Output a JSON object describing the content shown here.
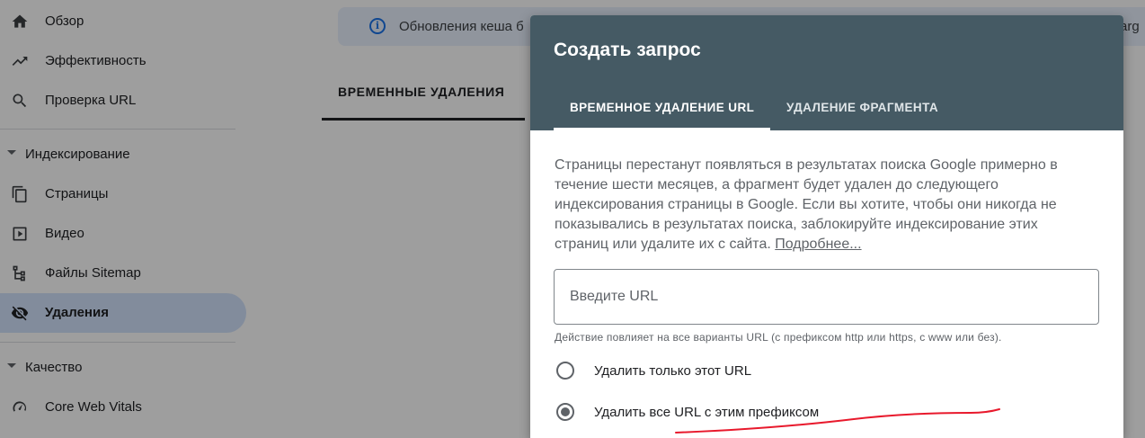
{
  "sidebar": {
    "items": [
      {
        "label": "Обзор",
        "icon": "home-icon"
      },
      {
        "label": "Эффективность",
        "icon": "trending-up-icon"
      },
      {
        "label": "Проверка URL",
        "icon": "search-icon"
      }
    ],
    "indexing": {
      "section_label": "Индексирование",
      "items": [
        {
          "label": "Страницы",
          "icon": "pages-icon"
        },
        {
          "label": "Видео",
          "icon": "video-icon"
        },
        {
          "label": "Файлы Sitemap",
          "icon": "sitemap-icon"
        },
        {
          "label": "Удаления",
          "icon": "eye-off-icon",
          "active": true
        }
      ]
    },
    "quality": {
      "section_label": "Качество",
      "items": [
        {
          "label": "Core Web Vitals",
          "icon": "gauge-icon"
        }
      ]
    }
  },
  "main": {
    "banner_text": "Обновления кеша б",
    "banner_text_right": "arg",
    "tab_label": "ВРЕМЕННЫЕ УДАЛЕНИЯ"
  },
  "dialog": {
    "title": "Создать запрос",
    "tabs": [
      {
        "label": "ВРЕМЕННОЕ УДАЛЕНИЕ URL",
        "selected": true
      },
      {
        "label": "УДАЛЕНИЕ ФРАГМЕНТА",
        "selected": false
      }
    ],
    "description": "Страницы перестанут появляться в результатах поиска Google примерно в течение шести месяцев, а фрагмент будет удален до следующего индексирования страницы в Google. Если вы хотите, чтобы они никогда не показывались в результатах поиска, заблокируйте индексирование этих страниц или удалите их с сайта.",
    "learn_more": "Подробнее...",
    "url_input": {
      "placeholder": "Введите URL",
      "value": ""
    },
    "hint": "Действие повлияет на все варианты URL (с префиксом http или https, с www или без).",
    "options": [
      {
        "label": "Удалить только этот URL",
        "checked": false
      },
      {
        "label": "Удалить все URL с этим префиксом",
        "checked": true
      }
    ]
  },
  "colors": {
    "dialog_header": "#455a64",
    "active_nav": "#d2e3fc",
    "annotation_stroke": "#e8192c"
  }
}
